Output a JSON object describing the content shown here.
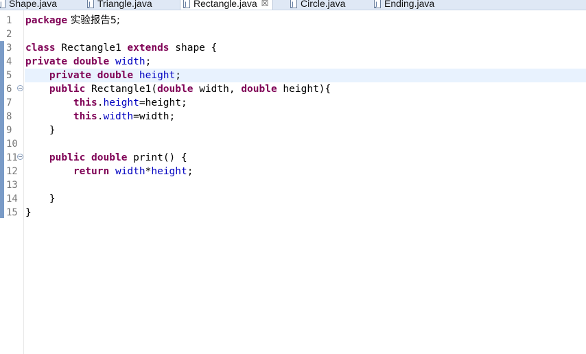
{
  "tabs": [
    {
      "label": "Shape.java",
      "active": false
    },
    {
      "label": "Triangle.java",
      "active": false
    },
    {
      "label": "Rectangle.java",
      "active": true,
      "close": "☒"
    },
    {
      "label": "Circle.java",
      "active": false
    },
    {
      "label": "Ending.java",
      "active": false
    }
  ],
  "line_numbers": [
    "1",
    "2",
    "3",
    "4",
    "5",
    "6",
    "7",
    "8",
    "9",
    "10",
    "11",
    "12",
    "13",
    "14",
    "15"
  ],
  "code": {
    "l1": {
      "kw": "package",
      "rest": " 实验报告5;"
    },
    "l3": {
      "kw1": "class",
      "name": " Rectangle1 ",
      "kw2": "extends",
      "rest": " shape {"
    },
    "l4": {
      "kw1": "private",
      "sp": " ",
      "kw2": "double",
      "sp2": " ",
      "field": "width",
      "end": ";"
    },
    "l5": {
      "indent": "    ",
      "kw1": "private",
      "sp": " ",
      "kw2": "double",
      "sp2": " ",
      "field": "height",
      "end": ";"
    },
    "l6": {
      "indent": "    ",
      "kw1": "public",
      "name": " Rectangle1(",
      "kw2": "double",
      "p1": " width, ",
      "kw3": "double",
      "p2": " height){"
    },
    "l7": {
      "indent": "        ",
      "kw": "this",
      "dot": ".",
      "field": "height",
      "rest": "=height;"
    },
    "l8": {
      "indent": "        ",
      "kw": "this",
      "dot": ".",
      "field": "width",
      "rest": "=width;"
    },
    "l9": {
      "text": "    }"
    },
    "l11": {
      "indent": "    ",
      "kw1": "public",
      "sp": " ",
      "kw2": "double",
      "rest": " print() {"
    },
    "l12": {
      "indent": "        ",
      "kw": "return",
      "sp": " ",
      "f1": "width",
      "op": "*",
      "f2": "height",
      "end": ";"
    },
    "l14": {
      "text": "    }"
    },
    "l15": {
      "text": "}"
    }
  },
  "colors": {
    "keyword": "#7f0055",
    "field": "#0000c0",
    "current_line": "#e8f2fe",
    "tab_bar": "#dfe8f5"
  }
}
